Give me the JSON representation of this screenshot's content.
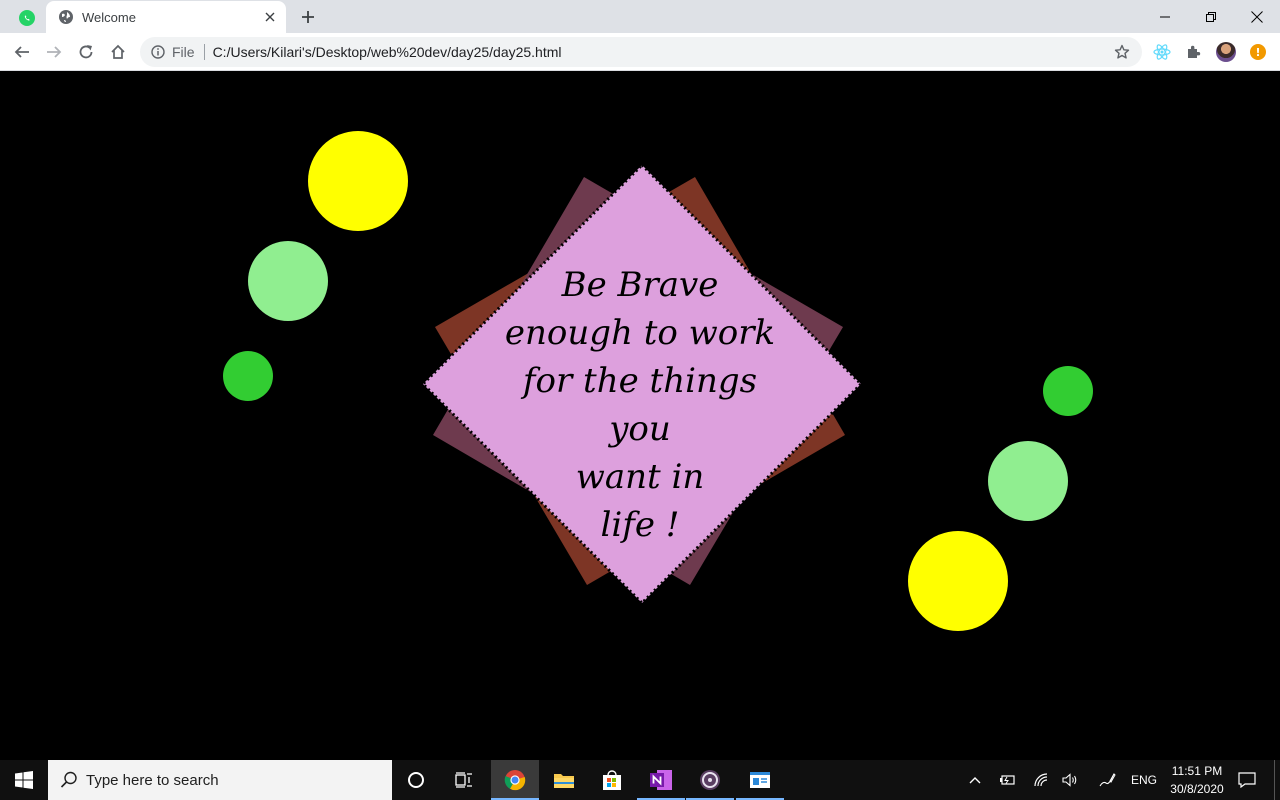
{
  "browser": {
    "tab_title": "Welcome",
    "omnibox": {
      "scheme_label": "File",
      "url": "C:/Users/Kilari's/Desktop/web%20dev/day25/day25.html"
    },
    "update_badge": "!"
  },
  "page": {
    "background": "#000000",
    "quote_lines": [
      "Be Brave",
      "enough to work",
      "for the things you",
      "want in",
      "life !"
    ],
    "colors": {
      "diamond_fill": "#dda0dd",
      "back_square_1": "#7d3525",
      "back_square_2": "#6e3a4e",
      "circle_yellow": "#ffff00",
      "circle_light_green": "#90ee90",
      "circle_green": "#32cd32"
    }
  },
  "taskbar": {
    "search_placeholder": "Type here to search",
    "tray": {
      "language": "ENG",
      "time": "11:51 PM",
      "date": "30/8/2020"
    }
  }
}
